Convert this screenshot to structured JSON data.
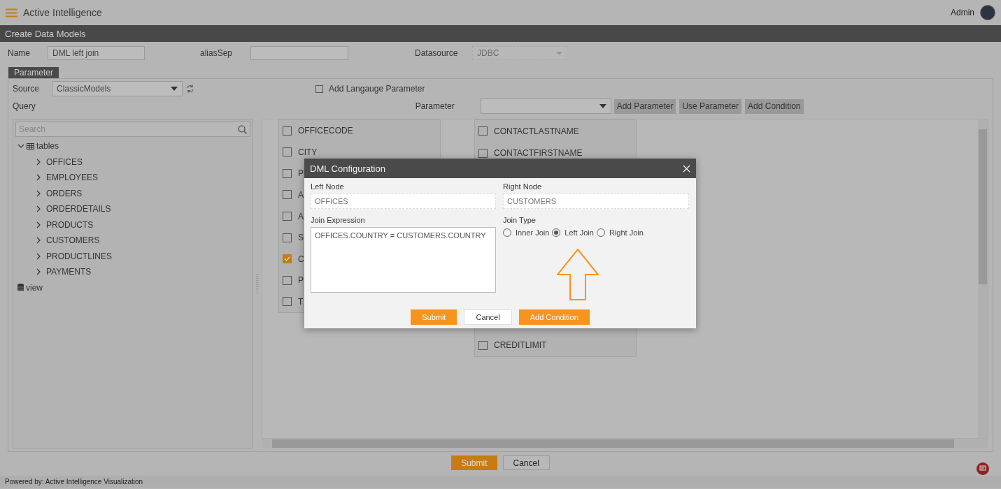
{
  "header": {
    "title": "Active Intelligence",
    "user": "Admin"
  },
  "page_title": "Create Data Models",
  "form": {
    "name_label": "Name",
    "name_value": "DML left join",
    "alias_label": "aliasSep",
    "datasource_label": "Datasource",
    "datasource_value": "JDBC"
  },
  "tabs": [
    {
      "label": "Parameter",
      "selected": true
    }
  ],
  "source": {
    "label": "Source",
    "value": "ClassicModels"
  },
  "language_checkbox": {
    "label": "Add Langauge Parameter",
    "checked": false
  },
  "query_label": "Query",
  "parameter_label": "Parameter",
  "toolbar_buttons": [
    "Add Parameter",
    "Use Parameter",
    "Add Condition"
  ],
  "tree": {
    "search_placeholder": "Search",
    "items": [
      {
        "label": "tables",
        "kind": "tables",
        "expanded": true,
        "children": [
          {
            "label": "OFFICES",
            "expanded": false
          },
          {
            "label": "EMPLOYEES",
            "expanded": false
          },
          {
            "label": "ORDERS",
            "expanded": false
          },
          {
            "label": "ORDERDETAILS",
            "expanded": false
          },
          {
            "label": "PRODUCTS",
            "expanded": false
          },
          {
            "label": "CUSTOMERS",
            "expanded": false
          },
          {
            "label": "PRODUCTLINES",
            "expanded": false
          },
          {
            "label": "PAYMENTS",
            "expanded": false
          }
        ]
      },
      {
        "label": "view",
        "kind": "view"
      }
    ]
  },
  "tables": [
    {
      "columns": [
        {
          "label": "OFFICECODE",
          "checked": false
        },
        {
          "label": "CITY",
          "checked": false
        },
        {
          "label": "P",
          "checked": false
        },
        {
          "label": "A",
          "checked": false
        },
        {
          "label": "A",
          "checked": false
        },
        {
          "label": "S",
          "checked": false
        },
        {
          "label": "C",
          "checked": true
        },
        {
          "label": "P",
          "checked": false
        },
        {
          "label": "T",
          "checked": false
        }
      ]
    },
    {
      "columns": [
        {
          "label": "CONTACTLASTNAME",
          "checked": false
        },
        {
          "label": "CONTACTFIRSTNAME",
          "checked": false
        },
        {
          "label": "CREDITLIMIT",
          "checked": false
        }
      ]
    }
  ],
  "dialog": {
    "title": "DML Configuration",
    "left_label": "Left Node",
    "left_value": "OFFICES",
    "right_label": "Right Node",
    "right_value": "CUSTOMERS",
    "expression_label": "Join Expression",
    "expression_value": "OFFICES.COUNTRY = CUSTOMERS.COUNTRY",
    "join_type_label": "Join Type",
    "join_types": [
      {
        "label": "Inner Join",
        "selected": false
      },
      {
        "label": "Left Join",
        "selected": true
      },
      {
        "label": "Right Join",
        "selected": false
      }
    ],
    "buttons": [
      {
        "label": "Submit",
        "kind": "primary"
      },
      {
        "label": "Cancel",
        "kind": "secondary"
      },
      {
        "label": "Add Condition",
        "kind": "primary"
      }
    ]
  },
  "footer_buttons": [
    {
      "label": "Submit",
      "kind": "primary"
    },
    {
      "label": "Cancel",
      "kind": "secondary"
    }
  ],
  "footer": "Powered by: Active Intelligence Visualization"
}
